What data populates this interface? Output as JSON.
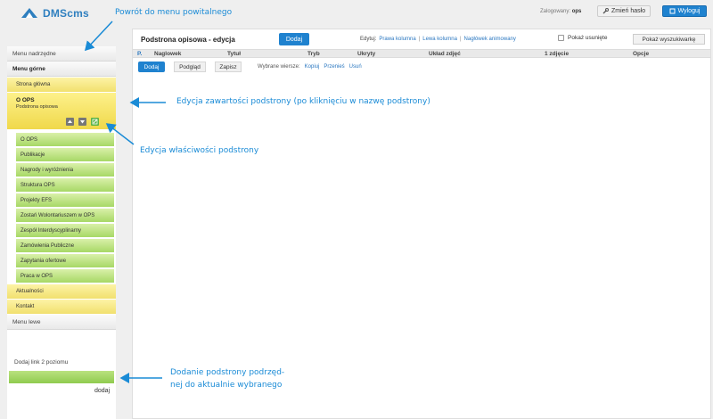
{
  "header": {
    "logo_text": "DMScms",
    "logged_label": "Zalogowany:",
    "logged_user": "ops",
    "change_password": "Zmień hasło",
    "logout": "Wyloguj"
  },
  "sidebar": {
    "menu_parent": "Menu nadrzędne",
    "menu_top": "Menu górne",
    "home": "Strona główna",
    "selected": {
      "title": "O OPS",
      "subtitle": "Podstrona opisowa"
    },
    "children": [
      "O OPS",
      "Publikacje",
      "Nagrody i wyróżnienia",
      "Struktura OPS",
      "Projekty EFS",
      "Zostań Wolontariuszem w OPS",
      "Zespół Interdyscyplinarny",
      "Zamówienia Publiczne",
      "Zapytania ofertowe",
      "Praca w OPS"
    ],
    "news": "Aktualności",
    "contact": "Kontakt",
    "menu_left": "Menu lewe",
    "add_level2": "Dodaj link 2 poziomu",
    "add_button": "dodaj"
  },
  "main": {
    "title": "Podstrona opisowa - edycja",
    "add_button": "Dodaj",
    "edit_label": "Edytuj:",
    "edit_links": [
      "Prawa kolumna",
      "Lewa kolumna",
      "Nagłówek animowany"
    ],
    "show_deleted": "Pokaż usunięte",
    "show_search": "Pokaż wyszukiwarkę",
    "columns": [
      "P.",
      "Naglowek",
      "Tytuł",
      "Tryb",
      "Ukryty",
      "Układ zdjęć",
      "1 zdjęcie",
      "Opcje"
    ],
    "toolbar": {
      "add": "Dodaj",
      "preview": "Podgląd",
      "save": "Zapisz",
      "selected_rows": "Wybrane wiersze:",
      "copy": "Kopiuj",
      "move": "Przenieś",
      "delete": "Usuń"
    }
  },
  "annotations": {
    "back_to_welcome": "Powrót do menu powitalnego",
    "edit_content": "Edycja zawartości podstrony (po kliknięciu w nazwę podstrony)",
    "edit_properties": "Edycja właściwości podstrony",
    "add_subpage_line1": "Dodanie podstrony podrzęd-",
    "add_subpage_line2": "nej do aktualnie wybranego"
  },
  "colors": {
    "accent": "#1f82cf",
    "annotation": "#1a8bd6",
    "menu_yellow": "#f1e06e",
    "menu_green": "#a7d866"
  }
}
